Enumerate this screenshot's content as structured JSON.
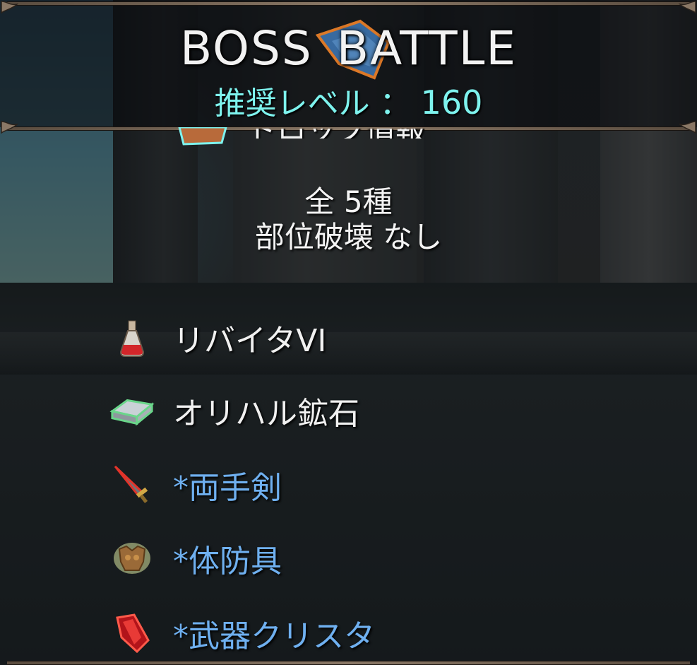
{
  "header": {
    "title_word1": "BOSS",
    "title_word2": "BATTLE",
    "level_label": "推奨レベル ：",
    "level_value": "160"
  },
  "drop_section": {
    "heading": "ドロップ情報",
    "count_prefix": "全",
    "count_value": "5種",
    "part_break": "部位破壊  なし"
  },
  "drops": [
    {
      "name": "リバイタVI",
      "icon": "potion-flask-icon",
      "type": "item"
    },
    {
      "name": "オリハル鉱石",
      "icon": "ore-ingot-icon",
      "type": "item"
    },
    {
      "name": "*両手剣",
      "icon": "two-handed-sword-icon",
      "type": "equipment"
    },
    {
      "name": "*体防具",
      "icon": "body-armor-icon",
      "type": "equipment"
    },
    {
      "name": "*武器クリスタ",
      "icon": "red-crystal-icon",
      "type": "equipment"
    }
  ],
  "colors": {
    "title": "#f2f2f2",
    "level": "#7ef3ee",
    "equipment_text": "#6fb0f0",
    "frame": "#8a7866"
  }
}
